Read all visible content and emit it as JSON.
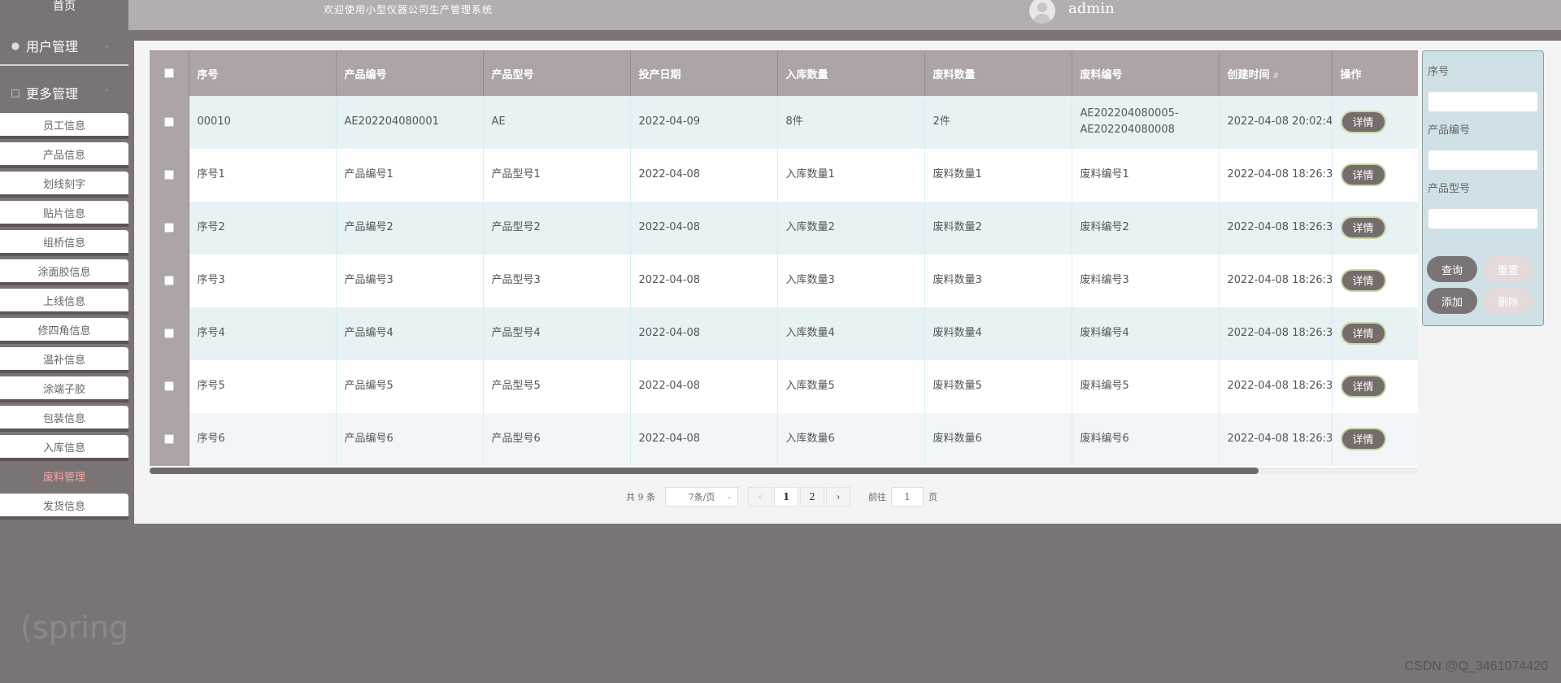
{
  "sidebar": {
    "home": "首页",
    "group1": "用户管理",
    "group2": "更多管理",
    "items": [
      "员工信息",
      "产品信息",
      "划线刻字",
      "贴片信息",
      "组桥信息",
      "涂面胶信息",
      "上线信息",
      "修四角信息",
      "温补信息",
      "涂端子胶",
      "包装信息",
      "入库信息",
      "废料管理",
      "发货信息"
    ],
    "active_index": 12
  },
  "header": {
    "welcome": "欢迎使用小型仪器公司生产管理系统",
    "username": "admin"
  },
  "table": {
    "columns": [
      "序号",
      "产品编号",
      "产品型号",
      "投产日期",
      "入库数量",
      "废料数量",
      "废料编号",
      "创建时间",
      "操作"
    ],
    "rows": [
      [
        "00010",
        "AE202204080001",
        "AE",
        "2022-04-09",
        "8件",
        "2件",
        "AE202204080005-AE202204080008",
        "2022-04-08 20:02:4"
      ],
      [
        "序号1",
        "产品编号1",
        "产品型号1",
        "2022-04-08",
        "入库数量1",
        "废料数量1",
        "废料编号1",
        "2022-04-08 18:26:3"
      ],
      [
        "序号2",
        "产品编号2",
        "产品型号2",
        "2022-04-08",
        "入库数量2",
        "废料数量2",
        "废料编号2",
        "2022-04-08 18:26:3"
      ],
      [
        "序号3",
        "产品编号3",
        "产品型号3",
        "2022-04-08",
        "入库数量3",
        "废料数量3",
        "废料编号3",
        "2022-04-08 18:26:3"
      ],
      [
        "序号4",
        "产品编号4",
        "产品型号4",
        "2022-04-08",
        "入库数量4",
        "废料数量4",
        "废料编号4",
        "2022-04-08 18:26:3"
      ],
      [
        "序号5",
        "产品编号5",
        "产品型号5",
        "2022-04-08",
        "入库数量5",
        "废料数量5",
        "废料编号5",
        "2022-04-08 18:26:3"
      ],
      [
        "序号6",
        "产品编号6",
        "产品型号6",
        "2022-04-08",
        "入库数量6",
        "废料数量6",
        "废料编号6",
        "2022-04-08 18:26:3"
      ]
    ],
    "detail_label": "详情"
  },
  "pagination": {
    "total": "共 9 条",
    "page_size": "7条/页",
    "prev": "‹",
    "pages": [
      "1",
      "2"
    ],
    "next": "›",
    "goto_label": "前往",
    "goto_value": "1",
    "goto_suffix": "页"
  },
  "search": {
    "label1": "序号",
    "label2": "产品编号",
    "label3": "产品型号",
    "query": "查询",
    "reset": "重置",
    "add": "添加",
    "delete": "删除"
  },
  "watermark": {
    "left": "(spring",
    "right": "CSDN @Q_3461074420"
  },
  "colors": {
    "sidebar": "#7b7475",
    "header": "#b4aeaf",
    "table_header": "#ada4a5",
    "row_alt": "#e8f1f3",
    "button": "#756d6b",
    "active_menu": "#f5a6a6",
    "search_panel": "#cfe0e6"
  }
}
